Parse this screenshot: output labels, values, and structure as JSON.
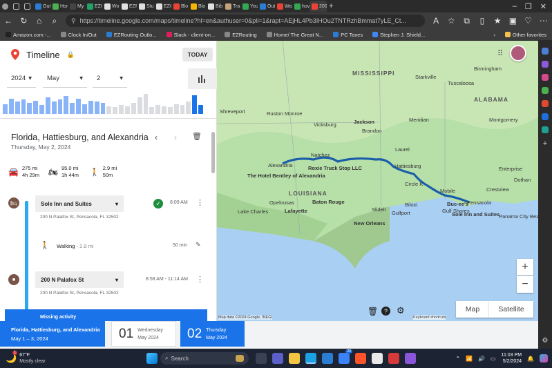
{
  "browser": {
    "tabs": [
      {
        "label": "Out",
        "color": "#2b7cd3"
      },
      {
        "label": "Hon",
        "color": "#4caf50"
      },
      {
        "label": "My",
        "color": "#444"
      },
      {
        "label": "EZC",
        "color": "#21a366"
      },
      {
        "label": "Wo",
        "color": "#e0e0e0"
      },
      {
        "label": "EZR",
        "color": "#e0e0e0"
      },
      {
        "label": "Stu",
        "color": "#e0e0e0"
      },
      {
        "label": "EZC",
        "color": "#e0e0e0"
      },
      {
        "label": "Blo",
        "color": "#ea4335"
      },
      {
        "label": "Blo",
        "color": "#f4b400"
      },
      {
        "label": "Bib",
        "color": "#e0e0e0"
      },
      {
        "label": "Tra",
        "color": "#c5a37a"
      },
      {
        "label": "You",
        "color": "#34a853"
      },
      {
        "label": "Out",
        "color": "#2b7cd3"
      },
      {
        "label": "Wa",
        "color": "#ea4335"
      },
      {
        "label": "hov",
        "color": "#34a853"
      },
      {
        "label": "200",
        "color": "#ea4335"
      }
    ],
    "url": "https://timeline.google.com/maps/timeline?hl=en&authuser=0&pli=1&rapt=AEjHL4Pb3IHOu2TNTRzhBmmat7yLE_Ct...",
    "bookmarks": [
      {
        "label": "Amazon.com -...",
        "color": "#222"
      },
      {
        "label": "Clock In/Out",
        "color": "#888"
      },
      {
        "label": "EZRouting Outlo...",
        "color": "#2b7cd3"
      },
      {
        "label": "Slack - client-on...",
        "color": "#e01e5a"
      },
      {
        "label": "EZRouting",
        "color": "#888"
      },
      {
        "label": "Home/ The Great N...",
        "color": "#888"
      },
      {
        "label": "PC Taxes",
        "color": "#2b7cd3"
      },
      {
        "label": "Stephen J. Shield...",
        "color": "#4285f4"
      }
    ],
    "other_favorites": "Other favorites"
  },
  "timeline": {
    "title": "Timeline",
    "today_button": "TODAY",
    "year": "2024",
    "month": "May",
    "day": "2",
    "day_title": "Florida, Hattiesburg, and Alexandria",
    "day_subtitle": "Thursday, May 2, 2024",
    "stats": [
      {
        "icon": "car-icon",
        "distance": "275 mi",
        "duration": "4h 29m"
      },
      {
        "icon": "motorcycle-icon",
        "distance": "95.0 mi",
        "duration": "1h 44m"
      },
      {
        "icon": "walking-icon",
        "distance": "2.9 mi",
        "duration": "50m"
      }
    ],
    "entries": [
      {
        "name": "Sole Inn and Suites",
        "address": "200 N Palafox St, Pensacola, FL 32502",
        "time": "8:09 AM"
      },
      {
        "name": "200 N Palafox St",
        "address": "200 N Palafox St, Pensacola, FL 32502",
        "time": "8:58 AM - 11:14 AM"
      }
    ],
    "activity": {
      "label": "Walking",
      "detail": "- 2.9 mi",
      "duration": "50 min"
    },
    "missing_label": "Missing activity",
    "activity_chart": [
      {
        "v": 0.45,
        "c": "#8ab4f8"
      },
      {
        "v": 0.7,
        "c": "#8ab4f8"
      },
      {
        "v": 0.55,
        "c": "#8ab4f8"
      },
      {
        "v": 0.65,
        "c": "#8ab4f8"
      },
      {
        "v": 0.5,
        "c": "#8ab4f8"
      },
      {
        "v": 0.6,
        "c": "#8ab4f8"
      },
      {
        "v": 0.4,
        "c": "#8ab4f8"
      },
      {
        "v": 0.75,
        "c": "#8ab4f8"
      },
      {
        "v": 0.55,
        "c": "#8ab4f8"
      },
      {
        "v": 0.65,
        "c": "#8ab4f8"
      },
      {
        "v": 0.8,
        "c": "#8ab4f8"
      },
      {
        "v": 0.5,
        "c": "#8ab4f8"
      },
      {
        "v": 0.7,
        "c": "#8ab4f8"
      },
      {
        "v": 0.45,
        "c": "#8ab4f8"
      },
      {
        "v": 0.6,
        "c": "#8ab4f8"
      },
      {
        "v": 0.55,
        "c": "#8ab4f8"
      },
      {
        "v": 0.5,
        "c": "#8ab4f8"
      },
      {
        "v": 0.35,
        "c": "#dadce0"
      },
      {
        "v": 0.3,
        "c": "#dadce0"
      },
      {
        "v": 0.4,
        "c": "#dadce0"
      },
      {
        "v": 0.35,
        "c": "#dadce0"
      },
      {
        "v": 0.5,
        "c": "#dadce0"
      },
      {
        "v": 0.75,
        "c": "#dadce0"
      },
      {
        "v": 0.9,
        "c": "#dadce0"
      },
      {
        "v": 0.3,
        "c": "#dadce0"
      },
      {
        "v": 0.4,
        "c": "#dadce0"
      },
      {
        "v": 0.35,
        "c": "#dadce0"
      },
      {
        "v": 0.3,
        "c": "#dadce0"
      },
      {
        "v": 0.45,
        "c": "#dadce0"
      },
      {
        "v": 0.4,
        "c": "#dadce0"
      },
      {
        "v": 0.55,
        "c": "#dadce0"
      },
      {
        "v": 0.85,
        "c": "#1a73e8"
      },
      {
        "v": 0.4,
        "c": "#1a73e8"
      }
    ]
  },
  "map": {
    "states": [
      "MISSISSIPPI",
      "ALABAMA",
      "LOUISIANA"
    ],
    "cities": [
      "Birmingham",
      "Tuscaloosa",
      "Starkville",
      "Shreveport",
      "Ruston",
      "Monroe",
      "Vicksburg",
      "Jackson",
      "Brandon",
      "Meridian",
      "Montgomery",
      "Natchez",
      "Alexandria",
      "Roxie Truck Stop LLC",
      "Laurel",
      "Hattiesburg",
      "Circle K",
      "Mobile",
      "The Hotel Bentley of Alexandria",
      "Lake Charles",
      "Opelousas",
      "Lafayette",
      "Baton Rouge",
      "Slidell",
      "New Orleans",
      "Biloxi",
      "Gulfport",
      "Buc-ee's",
      "Gulf Shores",
      "Crestview",
      "Pensacola",
      "Sole Inn and Suites",
      "Panama City Beach",
      "Enterprise",
      "Dothan"
    ],
    "attribution": "Map data ©2024 Google, INEGI",
    "shortcuts": "Keyboard shortcuts",
    "map_label": "Map",
    "satellite_label": "Satellite",
    "zoom_in": "+",
    "zoom_out": "−"
  },
  "bottom_cards": [
    {
      "kind": "range",
      "title": "Florida, Hattiesburg, and Alexandria",
      "sub": "May 1 – 3, 2024"
    },
    {
      "kind": "day",
      "num": "01",
      "weekday": "Wednesday",
      "month": "May 2024"
    },
    {
      "kind": "day",
      "num": "02",
      "weekday": "Thursday",
      "month": "May 2024"
    }
  ],
  "taskbar": {
    "weather_temp": "67°F",
    "weather_desc": "Mostly clear",
    "search_placeholder": "Search",
    "time": "11:03 PM",
    "date": "5/2/2024",
    "notif_count": "1",
    "store_badge": "20"
  }
}
